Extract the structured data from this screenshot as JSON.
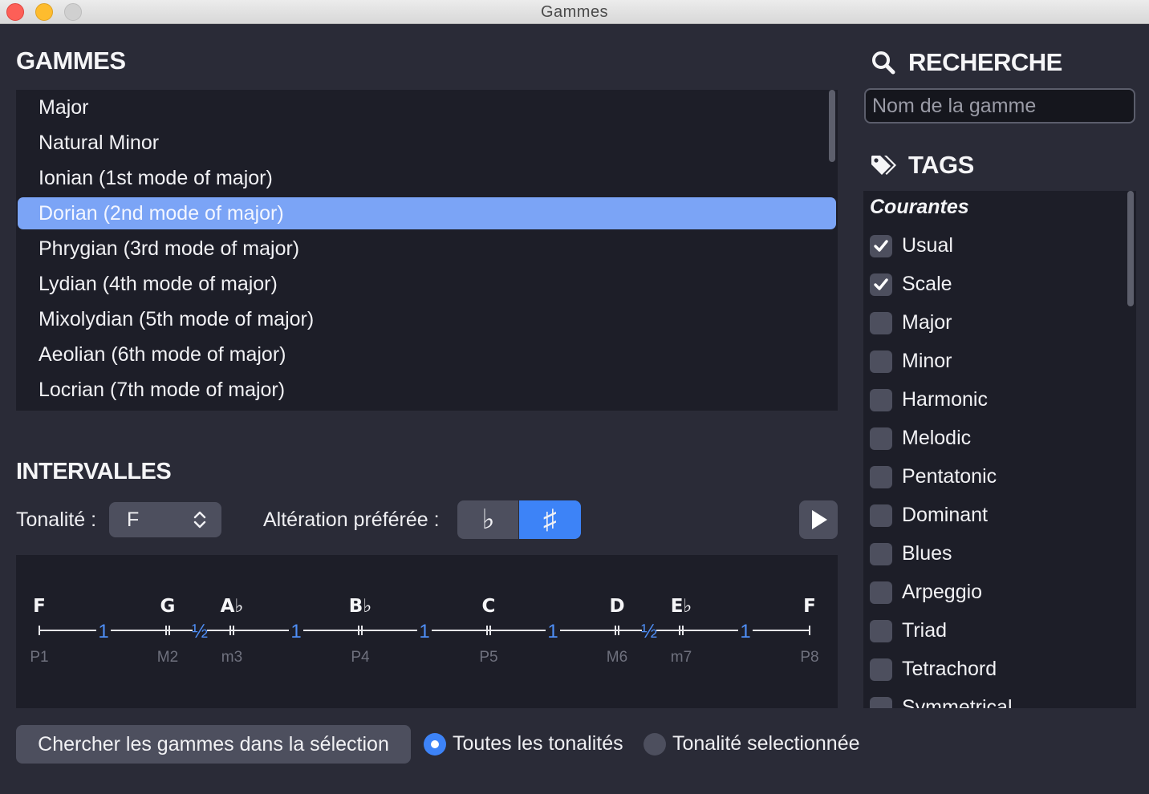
{
  "window": {
    "title": "Gammes"
  },
  "scales": {
    "heading": "GAMMES",
    "items": [
      "Major",
      "Natural Minor",
      "Ionian (1st mode of major)",
      "Dorian (2nd mode of major)",
      "Phrygian (3rd mode of major)",
      "Lydian (4th mode of major)",
      "Mixolydian (5th mode of major)",
      "Aeolian (6th mode of major)",
      "Locrian (7th mode of major)"
    ],
    "selected_index": 3
  },
  "intervals": {
    "heading": "INTERVALLES",
    "key_label": "Tonalité :",
    "key_value": "F",
    "accidental_label": "Altération préférée :",
    "flat_symbol": "♭",
    "sharp_symbol": "♯",
    "selected_accidental": "sharp",
    "notes": [
      {
        "name": "F",
        "degree": "P1"
      },
      {
        "name": "G",
        "degree": "M2"
      },
      {
        "name": "A♭",
        "degree": "m3"
      },
      {
        "name": "B♭",
        "degree": "P4"
      },
      {
        "name": "C",
        "degree": "P5"
      },
      {
        "name": "D",
        "degree": "M6"
      },
      {
        "name": "E♭",
        "degree": "m7"
      },
      {
        "name": "F",
        "degree": "P8"
      }
    ],
    "steps": [
      "1",
      "½",
      "1",
      "1",
      "1",
      "½",
      "1"
    ],
    "semitone_positions": [
      0,
      2,
      3,
      5,
      7,
      9,
      10,
      12
    ]
  },
  "search_button": "Chercher les gammes dans la sélection",
  "scope": {
    "all_keys": "Toutes les tonalités",
    "selected_key": "Tonalité selectionnée",
    "selected": "all_keys"
  },
  "search": {
    "heading": "RECHERCHE",
    "placeholder": "Nom de la gamme"
  },
  "tags": {
    "heading": "TAGS",
    "group": "Courantes",
    "items": [
      {
        "label": "Usual",
        "checked": true
      },
      {
        "label": "Scale",
        "checked": true
      },
      {
        "label": "Major",
        "checked": false
      },
      {
        "label": "Minor",
        "checked": false
      },
      {
        "label": "Harmonic",
        "checked": false
      },
      {
        "label": "Melodic",
        "checked": false
      },
      {
        "label": "Pentatonic",
        "checked": false
      },
      {
        "label": "Dominant",
        "checked": false
      },
      {
        "label": "Blues",
        "checked": false
      },
      {
        "label": "Arpeggio",
        "checked": false
      },
      {
        "label": "Triad",
        "checked": false
      },
      {
        "label": "Tetrachord",
        "checked": false
      },
      {
        "label": "Symmetrical",
        "checked": false
      }
    ]
  },
  "colors": {
    "accent": "#3d83f7",
    "selection": "#7ba4f6",
    "background": "#2a2b37",
    "panel": "#1d1e28",
    "control": "#4d4f5e",
    "step_label": "#4f8ff7"
  }
}
